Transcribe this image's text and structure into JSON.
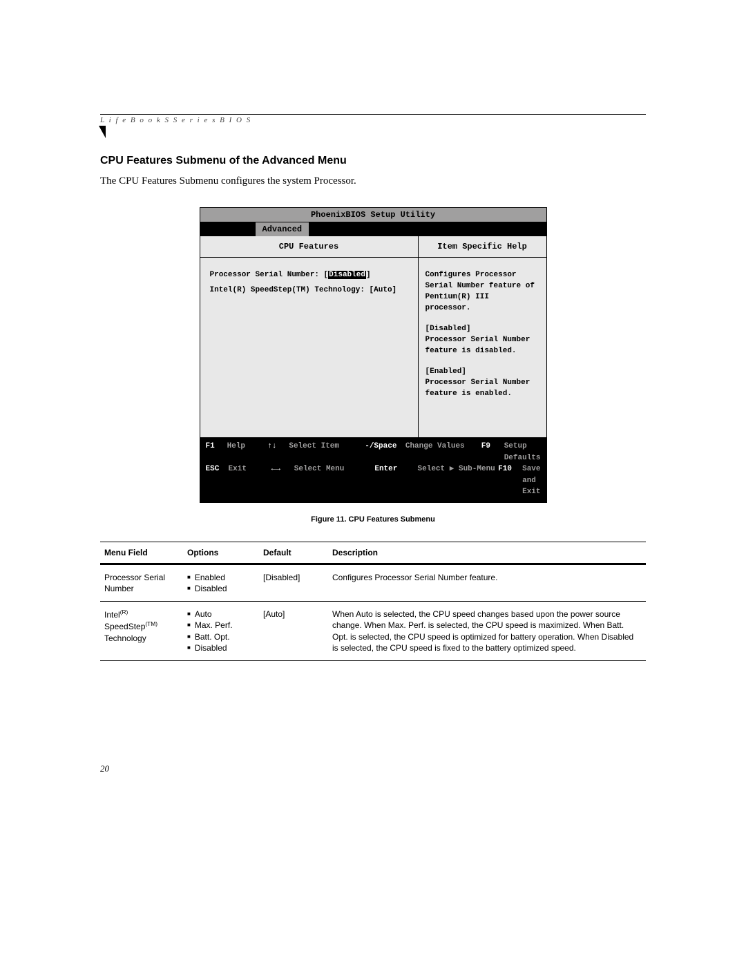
{
  "header": {
    "running_head": "L i f e B o o k   S   S e r i e s   B I O S"
  },
  "section": {
    "title": "CPU Features Submenu of the Advanced Menu",
    "intro": "The CPU Features Submenu configures the system Processor."
  },
  "bios": {
    "title": "PhoenixBIOS Setup Utility",
    "active_tab": "Advanced",
    "left_heading": "CPU Features",
    "right_heading": "Item Specific Help",
    "fields": [
      {
        "label": "Processor Serial Number:",
        "value": "Disabled",
        "selected": true
      },
      {
        "label": "Intel(R) SpeedStep(TM) Technology:",
        "value": "[Auto]",
        "selected": false
      }
    ],
    "help": {
      "p1": "Configures Processor Serial Number feature of Pentium(R) III processor.",
      "p2a": "[Disabled]",
      "p2b": "Processor Serial Number feature is disabled.",
      "p3a": "[Enabled]",
      "p3b": "Processor Serial Number feature is enabled."
    },
    "footer": {
      "r1": {
        "k1": "F1",
        "l1": "Help",
        "k2": "↑↓",
        "l2": "Select Item",
        "k3": "-/Space",
        "l3": "Change Values",
        "k4": "F9",
        "l4": "Setup Defaults"
      },
      "r2": {
        "k1": "ESC",
        "l1": "Exit",
        "k2": "←→",
        "l2": "Select Menu",
        "k3": "Enter",
        "l3": "Select ▶ Sub-Menu",
        "k4": "F10",
        "l4": "Save and Exit"
      }
    }
  },
  "figure_caption": "Figure 11. CPU Features Submenu",
  "table": {
    "headers": {
      "field": "Menu Field",
      "options": "Options",
      "def": "Default",
      "desc": "Description"
    },
    "rows": [
      {
        "field_html": "Processor Serial Number",
        "options": [
          "Enabled",
          "Disabled"
        ],
        "def": "[Disabled]",
        "desc": "Configures Processor Serial Number feature."
      },
      {
        "field_html": "Intel(R) SpeedStep(TM) Technology",
        "options": [
          "Auto",
          "Max. Perf.",
          "Batt. Opt.",
          "Disabled"
        ],
        "def": "[Auto]",
        "desc": "When Auto is selected, the CPU speed changes based upon the power source change. When Max. Perf. is selected, the CPU speed is maximized. When Batt. Opt. is selected, the CPU speed is optimized for battery operation. When Disabled is selected, the CPU speed is fixed to the battery optimized speed."
      }
    ]
  },
  "page_number": "20"
}
